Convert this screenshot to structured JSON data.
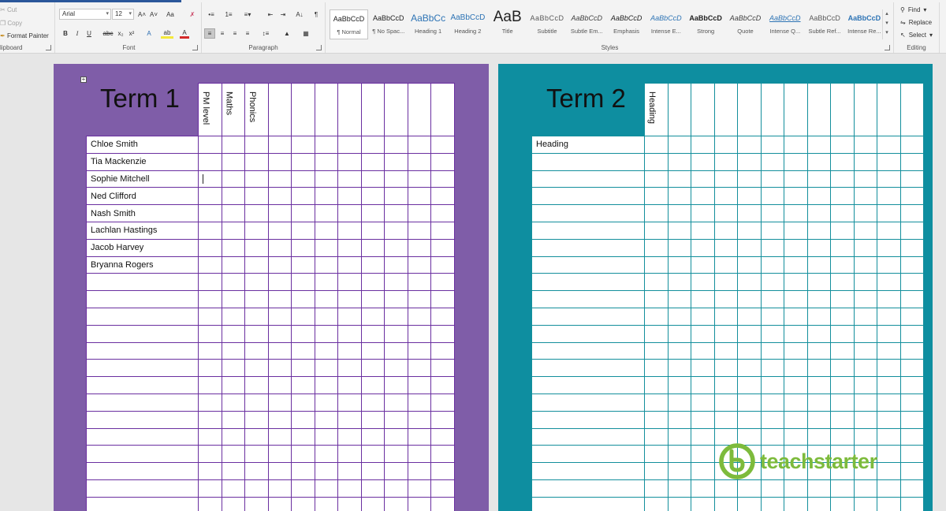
{
  "ribbon": {
    "clipboard": {
      "label": "lipboard",
      "cut": "Cut",
      "copy": "Copy",
      "format_painter": "Format Painter"
    },
    "font": {
      "label": "Font",
      "font_name": "Arial",
      "font_size": "12",
      "grow": "A˄",
      "shrink": "A˅",
      "change_case": "Aa",
      "bold": "B",
      "italic": "I",
      "underline": "U",
      "strike": "abc",
      "subscript": "x₂",
      "superscript": "x²",
      "text_effects": "A",
      "highlight": "ab",
      "font_color": "A"
    },
    "paragraph": {
      "label": "Paragraph",
      "pilcrow": "¶"
    },
    "styles": {
      "label": "Styles",
      "items": [
        {
          "sample": "AaBbCcD",
          "name": "¶ Normal"
        },
        {
          "sample": "AaBbCcD",
          "name": "¶ No Spac..."
        },
        {
          "sample": "AaBbCc",
          "name": "Heading 1"
        },
        {
          "sample": "AaBbCcD",
          "name": "Heading 2"
        },
        {
          "sample": "AaB",
          "name": "Title"
        },
        {
          "sample": "AaBbCcD",
          "name": "Subtitle"
        },
        {
          "sample": "AaBbCcD",
          "name": "Subtle Em..."
        },
        {
          "sample": "AaBbCcD",
          "name": "Emphasis"
        },
        {
          "sample": "AaBbCcD",
          "name": "Intense E..."
        },
        {
          "sample": "AaBbCcD",
          "name": "Strong"
        },
        {
          "sample": "AaBbCcD",
          "name": "Quote"
        },
        {
          "sample": "AaBbCcD",
          "name": "Intense Q..."
        },
        {
          "sample": "AaBbCcD",
          "name": "Subtle Ref..."
        },
        {
          "sample": "AaBbCcD",
          "name": "Intense Re..."
        }
      ]
    },
    "editing": {
      "label": "Editing",
      "find": "Find",
      "replace": "Replace",
      "select": "Select"
    }
  },
  "document": {
    "term1": {
      "title": "Term 1",
      "headers": [
        "PM level",
        "Maths",
        "Phonics",
        "",
        "",
        "",
        "",
        "",
        "",
        "",
        ""
      ],
      "students": [
        "Chloe Smith",
        "Tia Mackenzie",
        "Sophie Mitchell",
        "Ned Clifford",
        "Nash Smith",
        "Lachlan Hastings",
        "Jacob Harvey",
        "Bryanna Rogers",
        "",
        "",
        "",
        "",
        "",
        "",
        "",
        "",
        "",
        "",
        "",
        "",
        "",
        ""
      ],
      "accent_color": "#7f5da8",
      "line_color": "#6a2fa0"
    },
    "term2": {
      "title": "Term 2",
      "headers": [
        "Heading",
        "",
        "",
        "",
        "",
        "",
        "",
        "",
        "",
        "",
        "",
        ""
      ],
      "students": [
        "Heading",
        "",
        "",
        "",
        "",
        "",
        "",
        "",
        "",
        "",
        "",
        "",
        "",
        "",
        "",
        "",
        "",
        "",
        "",
        "",
        "",
        ""
      ],
      "accent_color": "#0e8ea0",
      "line_color": "#138f9c"
    }
  },
  "logo": {
    "text": "teachstarter",
    "color": "#7dbb3c"
  }
}
